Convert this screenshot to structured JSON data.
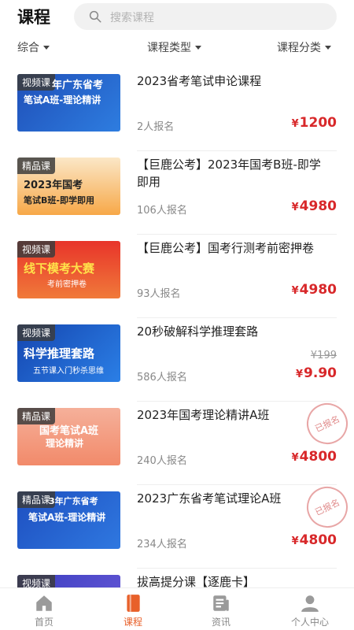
{
  "header": {
    "title": "课程",
    "search_placeholder": "搜索课程"
  },
  "filters": [
    {
      "label": "综合"
    },
    {
      "label": "课程类型"
    },
    {
      "label": "课程分类"
    }
  ],
  "courses": [
    {
      "tag": "视频课",
      "thumb_line1": "年广东省考",
      "thumb_line2": "笔试A班-理论精讲",
      "title": "2023省考笔试申论课程",
      "enroll": "2人报名",
      "price": "1200",
      "yen": "¥",
      "enrolled": ""
    },
    {
      "tag": "精品课",
      "thumb_line1": "2023年国考",
      "thumb_line2": "笔试B班-即学即用",
      "title": "【巨鹿公考】2023年国考B班-即学即用",
      "enroll": "106人报名",
      "price": "4980",
      "yen": "¥",
      "enrolled": ""
    },
    {
      "tag": "视频课",
      "thumb_line1": "线下模考大赛",
      "thumb_line2": "考前密押卷",
      "title": "【巨鹿公考】国考行测考前密押卷",
      "enroll": "93人报名",
      "price": "4980",
      "yen": "¥",
      "enrolled": ""
    },
    {
      "tag": "视频课",
      "thumb_line1": "科学推理套路",
      "thumb_line2": "五节课入门秒杀思维",
      "title": "20秒破解科学推理套路",
      "enroll": "586人报名",
      "price": "9.90",
      "yen": "¥",
      "orig_price": "¥199",
      "enrolled": ""
    },
    {
      "tag": "精品课",
      "thumb_line1": "国考笔试A班",
      "thumb_line2": "理论精讲",
      "title": "2023年国考理论精讲A班",
      "enroll": "240人报名",
      "price": "4800",
      "yen": "¥",
      "enrolled": "已报名"
    },
    {
      "tag": "精品课",
      "thumb_line1": "3年广东省考",
      "thumb_line2": "笔试A班-理论精讲",
      "title": "2023广东省考笔试理论A班",
      "enroll": "234人报名",
      "price": "4800",
      "yen": "¥",
      "enrolled": "已报名"
    },
    {
      "tag": "视频课",
      "thumb_line1": "",
      "thumb_line2": "",
      "title": "拔高提分课【逐鹿卡】",
      "enroll": "",
      "price": "",
      "yen": "",
      "enrolled": ""
    }
  ],
  "tabs": [
    {
      "label": "首页",
      "icon": "home-icon"
    },
    {
      "label": "课程",
      "icon": "book-icon"
    },
    {
      "label": "资讯",
      "icon": "news-icon"
    },
    {
      "label": "个人中心",
      "icon": "user-icon"
    }
  ],
  "colors": {
    "accent": "#e8602a",
    "price": "#d8282a"
  }
}
